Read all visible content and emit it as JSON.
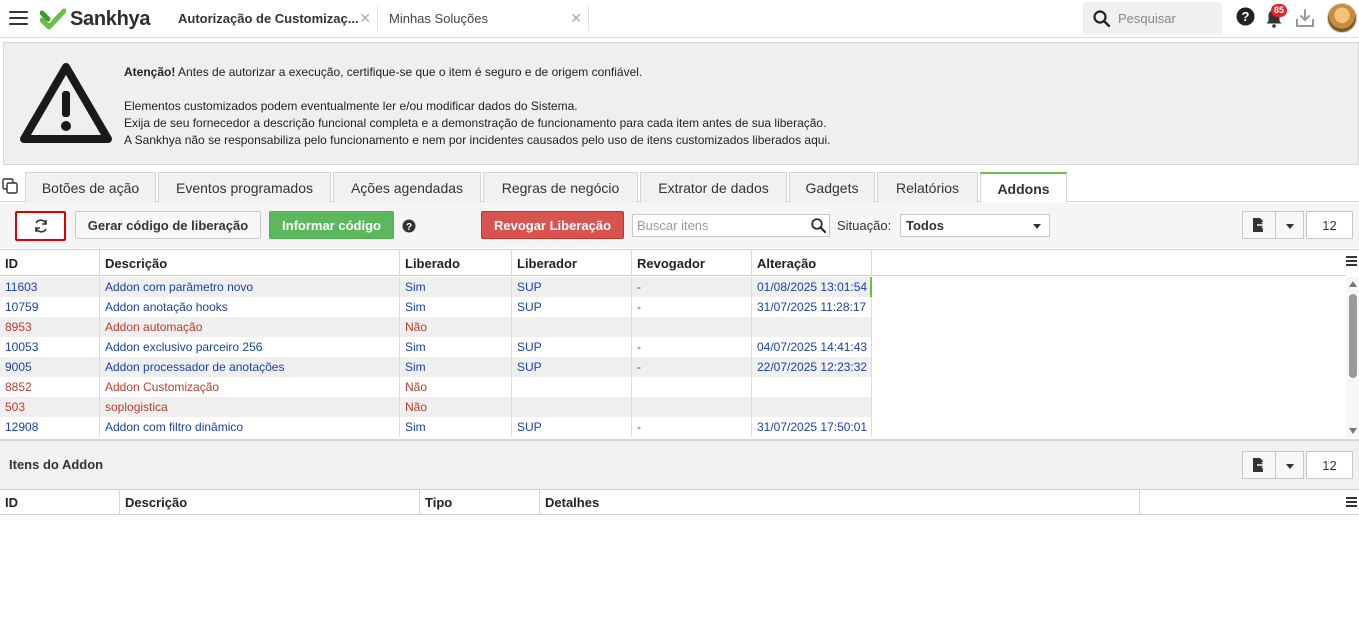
{
  "topbar": {
    "logo_text": "Sankhya",
    "tabs": [
      {
        "label": "Autorização de Customizaç...",
        "active": true
      },
      {
        "label": "Minhas Soluções",
        "active": false
      }
    ],
    "search_placeholder": "Pesquisar",
    "notification_count": "85"
  },
  "warning": {
    "title": "Atenção!",
    "line1": " Antes de autorizar a execução, certifique-se que o item é seguro e de origem confiável.",
    "line2": "Elementos customizados podem eventualmente ler e/ou modificar dados do Sistema.",
    "line3": "Exija de seu fornecedor a descrição funcional completa e a demonstração de funcionamento para cada item antes de sua liberação.",
    "line4": "A Sankhya não se responsabiliza pelo funcionamento e nem por incidentes causados pelo uso de itens customizados liberados aqui."
  },
  "tabs": [
    {
      "label": "Botões de ação"
    },
    {
      "label": "Eventos programados"
    },
    {
      "label": "Ações agendadas"
    },
    {
      "label": "Regras de negócio"
    },
    {
      "label": "Extrator de dados"
    },
    {
      "label": "Gadgets"
    },
    {
      "label": "Relatórios"
    },
    {
      "label": "Addons",
      "active": true
    }
  ],
  "toolbar": {
    "gerar_label": "Gerar código de liberação",
    "informar_label": "Informar código",
    "revogar_label": "Revogar Liberação",
    "search_placeholder": "Buscar itens",
    "situacao_label": "Situação:",
    "situacao_value": "Todos",
    "page_size": "12"
  },
  "grid": {
    "columns": [
      "ID",
      "Descrição",
      "Liberado",
      "Liberador",
      "Revogador",
      "Alteração"
    ],
    "rows": [
      {
        "id": "11603",
        "descricao": "Addon com parâmetro novo",
        "liberado": "Sim",
        "liberador": "SUP",
        "revogador": "-",
        "alteracao": "01/08/2025 13:01:54"
      },
      {
        "id": "10759",
        "descricao": "Addon anotação hooks",
        "liberado": "Sim",
        "liberador": "SUP",
        "revogador": "-",
        "alteracao": "31/07/2025 11:28:17"
      },
      {
        "id": "8953",
        "descricao": "Addon automação",
        "liberado": "Não",
        "liberador": "",
        "revogador": "",
        "alteracao": ""
      },
      {
        "id": "10053",
        "descricao": "Addon exclusivo parceiro 256",
        "liberado": "Sim",
        "liberador": "SUP",
        "revogador": "-",
        "alteracao": "04/07/2025 14:41:43"
      },
      {
        "id": "9005",
        "descricao": "Addon processador de anotações",
        "liberado": "Sim",
        "liberador": "SUP",
        "revogador": "-",
        "alteracao": "22/07/2025 12:23:32"
      },
      {
        "id": "8852",
        "descricao": "Addon Customização",
        "liberado": "Não",
        "liberador": "",
        "revogador": "",
        "alteracao": ""
      },
      {
        "id": "503",
        "descricao": "soplogistica",
        "liberado": "Não",
        "liberador": "",
        "revogador": "",
        "alteracao": ""
      },
      {
        "id": "12908",
        "descricao": "Addon com filtro dinâmico",
        "liberado": "Sim",
        "liberador": "SUP",
        "revogador": "-",
        "alteracao": "31/07/2025 17:50:01"
      }
    ]
  },
  "items": {
    "title": "Itens do Addon",
    "page_size": "12",
    "columns": [
      "ID",
      "Descrição",
      "Tipo",
      "Detalhes"
    ]
  }
}
